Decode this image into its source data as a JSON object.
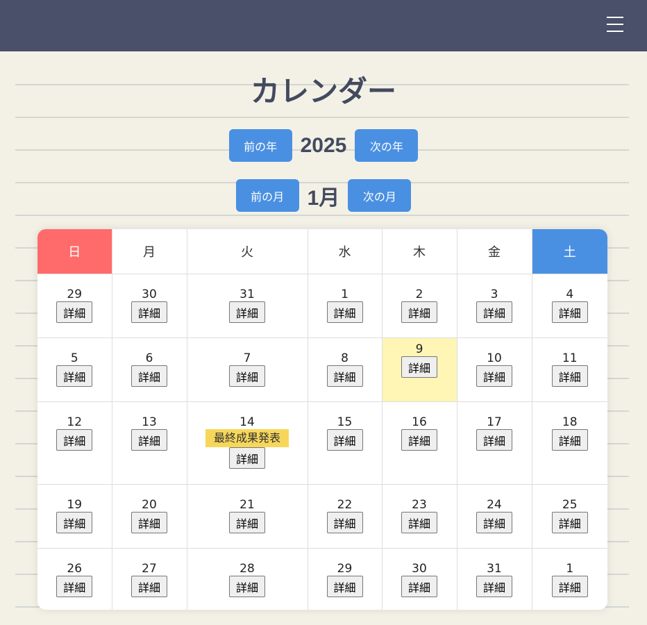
{
  "header": {
    "menu_icon": "hamburger-menu-icon",
    "background": "#4a506a"
  },
  "page": {
    "title": "カレンダー"
  },
  "year_nav": {
    "prev_label": "前の年",
    "value": "2025",
    "next_label": "次の年"
  },
  "month_nav": {
    "prev_label": "前の月",
    "value": "1月",
    "next_label": "次の月"
  },
  "colors": {
    "accent": "#4a90e2",
    "sunday": "#ff6b6b",
    "saturday": "#4a90e2",
    "today": "#fff5b5",
    "event": "#f7d75b"
  },
  "calendar": {
    "weekdays": [
      "日",
      "月",
      "火",
      "水",
      "木",
      "金",
      "土"
    ],
    "detail_label": "詳細",
    "weeks": [
      [
        {
          "day": "29"
        },
        {
          "day": "30"
        },
        {
          "day": "31"
        },
        {
          "day": "1"
        },
        {
          "day": "2"
        },
        {
          "day": "3"
        },
        {
          "day": "4"
        }
      ],
      [
        {
          "day": "5"
        },
        {
          "day": "6"
        },
        {
          "day": "7"
        },
        {
          "day": "8"
        },
        {
          "day": "9",
          "today": true
        },
        {
          "day": "10"
        },
        {
          "day": "11"
        }
      ],
      [
        {
          "day": "12"
        },
        {
          "day": "13"
        },
        {
          "day": "14",
          "event": "最終成果発表"
        },
        {
          "day": "15"
        },
        {
          "day": "16"
        },
        {
          "day": "17"
        },
        {
          "day": "18"
        }
      ],
      [
        {
          "day": "19"
        },
        {
          "day": "20"
        },
        {
          "day": "21"
        },
        {
          "day": "22"
        },
        {
          "day": "23"
        },
        {
          "day": "24"
        },
        {
          "day": "25"
        }
      ],
      [
        {
          "day": "26"
        },
        {
          "day": "27"
        },
        {
          "day": "28"
        },
        {
          "day": "29"
        },
        {
          "day": "30"
        },
        {
          "day": "31"
        },
        {
          "day": "1"
        }
      ]
    ]
  }
}
